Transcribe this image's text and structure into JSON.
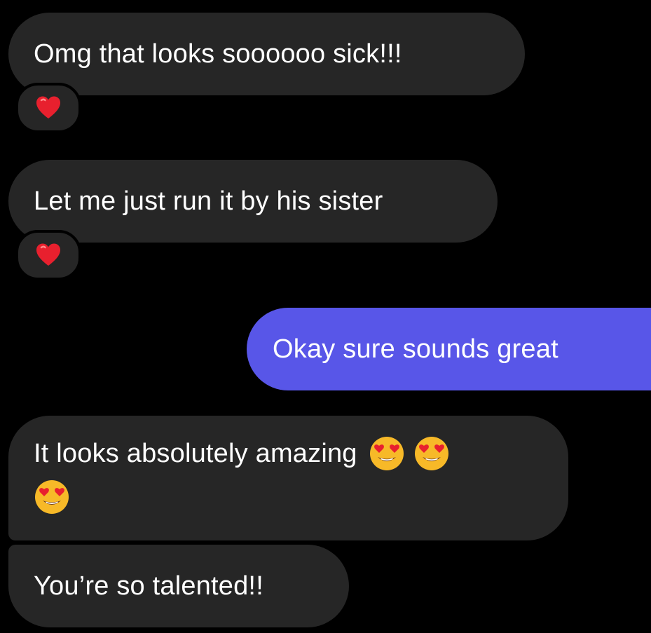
{
  "messages": [
    {
      "direction": "incoming",
      "text": "Omg that looks soooooo sick!!!",
      "reaction": "heart-reaction"
    },
    {
      "direction": "incoming",
      "text": "Let me just run it by his sister",
      "reaction": "heart-reaction"
    },
    {
      "direction": "outgoing",
      "text": "Okay sure sounds great"
    },
    {
      "direction": "incoming",
      "text": "It looks absolutely amazing",
      "emojis": [
        "heart-eyes-emoji",
        "heart-eyes-emoji",
        "heart-eyes-emoji"
      ]
    },
    {
      "direction": "incoming",
      "text": "You’re so talented!!"
    }
  ],
  "colors": {
    "background": "#000000",
    "incoming_bubble": "#262626",
    "outgoing_bubble": "#5856e8",
    "text": "#ffffff",
    "heart": "#e8202e",
    "emoji_face": "#f7b928"
  }
}
